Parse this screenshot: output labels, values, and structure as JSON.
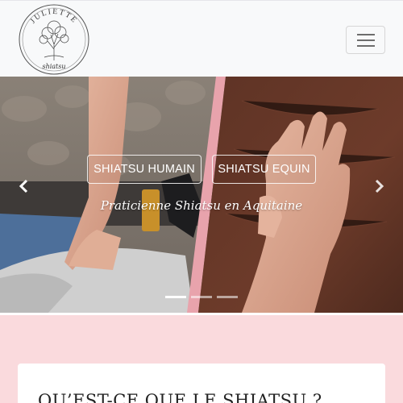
{
  "brand": {
    "logo_text_top": "JULIETTE",
    "logo_text_bottom": "shiatsu"
  },
  "navbar": {
    "toggler_icon": "hamburger-icon"
  },
  "hero": {
    "buttons": [
      "SHIATSU HUMAIN",
      "SHIATSU EQUIN"
    ],
    "tagline": "Praticienne Shiatsu en Aquitaine",
    "prev_icon": "chevron-left-icon",
    "next_icon": "chevron-right-icon",
    "slides_count": 3,
    "active_slide": 1
  },
  "section": {
    "heading": "QU’EST-CE QUE LE SHIATSU ?"
  },
  "colors": {
    "section_bg": "#fadadd",
    "divider_pink": "#e8a3ac",
    "horse_brown": "#6b3a2a"
  }
}
